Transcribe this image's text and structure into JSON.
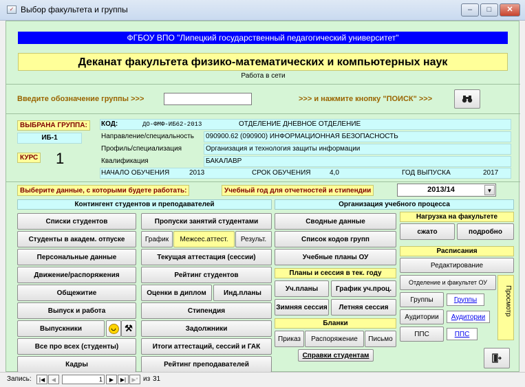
{
  "window": {
    "title": "Выбор факультета и группы",
    "icon": "app-form-icon",
    "controls": {
      "minimize": "–",
      "maximize": "□",
      "close": "✕"
    }
  },
  "header": {
    "university": "ФГБОУ ВПО \"Липецкий государственный педагогический университет\"",
    "dean_office": "Деканат факультета физико-математических и компьютерных наук",
    "mode": "Работа в сети"
  },
  "search": {
    "prompt": "Введите обозначение группы >>>",
    "value": "",
    "hint": ">>> и нажмите кнопку \"ПОИСК\" >>>",
    "button_icon": "binoculars-icon"
  },
  "group_info": {
    "selected_label": "ВЫБРАНА ГРУППА:",
    "group": "ИБ-1",
    "course_label": "КУРС",
    "course": "1",
    "code_label": "КОД:",
    "code": "ДО-ФМФ-ИБ62-2013",
    "department": "ОТДЕЛЕНИЕ ДНЕВНОЕ ОТДЕЛЕНИЕ",
    "specialty_label": "Направление/специальность",
    "specialty": "090900.62 (090900) ИНФОРМАЦИОННАЯ БЕЗОПАСНОСТЬ",
    "profile_label": "Профиль/специализация",
    "profile": "Организация и технология защиты информации",
    "qualification_label": "Квалификация",
    "qualification": "БАКАЛАВР",
    "start_label": "НАЧАЛО ОБУЧЕНИЯ",
    "start": "2013",
    "duration_label": "СРОК ОБУЧЕНИЯ",
    "duration": "4,0",
    "grad_label": "ГОД ВЫПУСКА",
    "grad": "2017"
  },
  "work_select": {
    "prompt": "Выберите данные, с которыми будете работать:",
    "year_label": "Учебный год для отчетностей и стипендии",
    "year": "2013/14"
  },
  "contingent": {
    "title": "Контингент студентов и преподавателей",
    "students_list": "Списки студентов",
    "academic_leave": "Студенты в академ. отпуске",
    "personal_data": "Персональные данные",
    "movement": "Движение/распоряжения",
    "dormitory": "Общежитие",
    "graduation_work": "Выпуск и работа",
    "alumni": "Выпускники",
    "all_about_all": "Все про всех (студенты)",
    "staff": "Кадры",
    "absences": "Пропуски занятий студентами",
    "schedule_tab": "График",
    "interim_tab": "Межсес.аттест.",
    "result_tab": "Результ.",
    "current_attestation": "Текущая аттестация (сессии)",
    "rating_students": "Рейтинг студентов",
    "diploma_grades": "Оценки в диплом",
    "ind_plans": "Инд.планы",
    "stipend": "Стипендия",
    "debtors": "Задолжники",
    "results": "Итоги аттестаций, сессий и ГАК",
    "rating_teachers": "Рейтинг преподавателей"
  },
  "process": {
    "title": "Организация учебного процесса",
    "summary": "Сводные данные",
    "group_codes": "Список кодов групп",
    "curricula": "Учебные планы ОУ",
    "plans_title": "Планы и сессия в тек. году",
    "study_plans": "Уч.планы",
    "study_schedule": "График уч.проц.",
    "winter_session": "Зимняя сессия",
    "summer_session": "Летняя сессия",
    "forms_title": "Бланки",
    "order": "Приказ",
    "directive": "Распоряжение",
    "letter": "Письмо",
    "certificates": "Справки студентам"
  },
  "faculty_load": {
    "title": "Нагрузка на факультете",
    "compact": "сжато",
    "detailed": "подробно"
  },
  "schedules": {
    "title": "Расписания",
    "edit": "Редактирование",
    "dept_faculty": "Отделение и факультет ОУ",
    "groups": "Группы",
    "groups_link": "Группы",
    "rooms": "Аудитории",
    "rooms_link": "Аудитории",
    "teachers": "ППС",
    "teachers_link": "ППС",
    "view": "Просмотр"
  },
  "status": {
    "record_label": "Запись:",
    "current": "1",
    "of_label": "из",
    "total": "31"
  }
}
